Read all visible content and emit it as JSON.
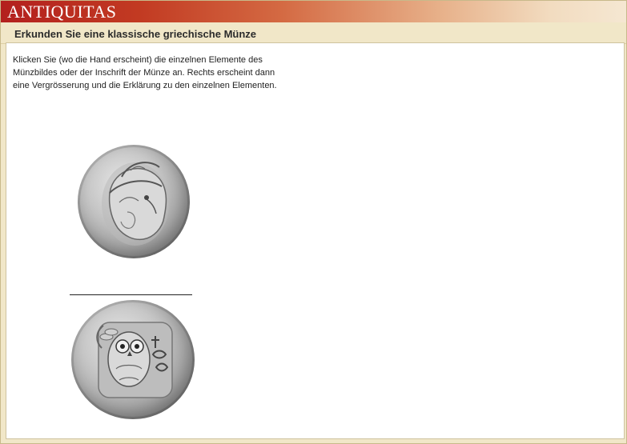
{
  "header": {
    "logo_text": "ANTIQUITAS",
    "subtitle": "Erkunden Sie eine klassische griechische Münze"
  },
  "content": {
    "instructions": "Klicken Sie (wo die Hand erscheint) die einzelnen Elemente des Münzbildes oder der Inschrift der Münze an. Rechts  erscheint dann eine Vergrösserung und die Erklärung zu den einzelnen Elementen."
  },
  "coins": {
    "obverse_icon": "coin-obverse-athena-icon",
    "reverse_icon": "coin-reverse-owl-icon"
  },
  "colors": {
    "brand_red": "#b3201e",
    "background": "#f1e7c8",
    "panel": "#ffffff"
  }
}
